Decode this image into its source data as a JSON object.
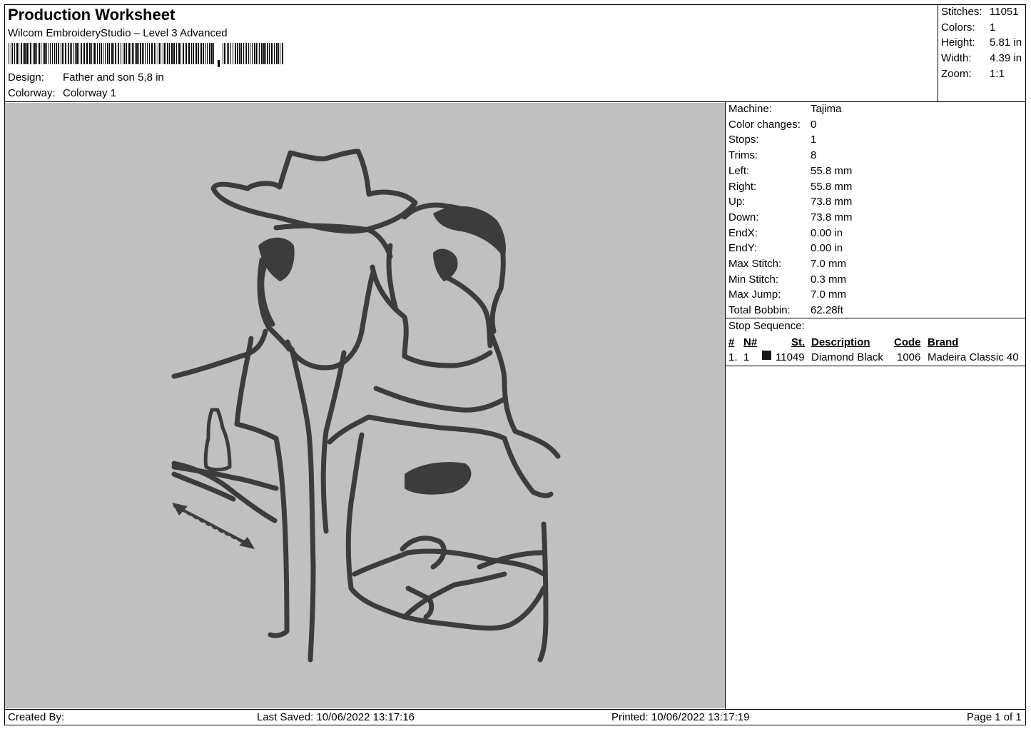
{
  "header": {
    "title": "Production Worksheet",
    "software": "Wilcom EmbroideryStudio – Level 3 Advanced",
    "design_label": "Design:",
    "design_value": "Father and son 5,8 in",
    "colorway_label": "Colorway:",
    "colorway_value": "Colorway 1"
  },
  "summary": {
    "stitches_label": "Stitches:",
    "stitches_value": "11051",
    "colors_label": "Colors:",
    "colors_value": "1",
    "height_label": "Height:",
    "height_value": "5.81 in",
    "width_label": "Width:",
    "width_value": "4.39 in",
    "zoom_label": "Zoom:",
    "zoom_value": "1:1"
  },
  "machine_info": [
    {
      "label": "Machine:",
      "value": "Tajima"
    },
    {
      "label": "Color changes:",
      "value": "0"
    },
    {
      "label": "Stops:",
      "value": "1"
    },
    {
      "label": "Trims:",
      "value": "8"
    },
    {
      "label": "Left:",
      "value": "55.8 mm"
    },
    {
      "label": "Right:",
      "value": "55.8 mm"
    },
    {
      "label": "Up:",
      "value": "73.8 mm"
    },
    {
      "label": "Down:",
      "value": "73.8 mm"
    },
    {
      "label": "EndX:",
      "value": "0.00 in"
    },
    {
      "label": "EndY:",
      "value": "0.00 in"
    },
    {
      "label": "Max Stitch:",
      "value": "7.0 mm"
    },
    {
      "label": "Min Stitch:",
      "value": "0.3 mm"
    },
    {
      "label": "Max Jump:",
      "value": "7.0 mm"
    },
    {
      "label": "Total Bobbin:",
      "value": "62.28ft"
    }
  ],
  "stop_sequence": {
    "title": "Stop Sequence:",
    "columns": {
      "num": "#",
      "n": "N#",
      "st": "St.",
      "description": "Description",
      "code": "Code",
      "brand": "Brand"
    },
    "rows": [
      {
        "num": "1.",
        "n": "1",
        "swatch_color": "#1a1a1a",
        "st": "11049",
        "description": "Diamond Black",
        "code": "1006",
        "brand": "Madeira Classic 40"
      }
    ]
  },
  "footer": {
    "created_by": "Created By:",
    "last_saved": "Last Saved: 10/06/2022 13:17:16",
    "printed": "Printed: 10/06/2022 13:17:19",
    "page": "Page 1 of 1"
  },
  "colors": {
    "preview_bg": "#c0c0c0",
    "thread": "#3c3d3a"
  }
}
